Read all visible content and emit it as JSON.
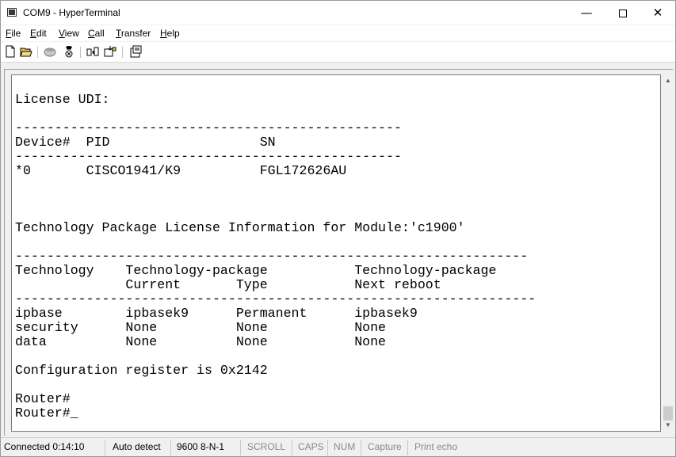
{
  "window": {
    "title": "COM9 - HyperTerminal"
  },
  "controls": {
    "minimize": "—",
    "close": "✕"
  },
  "menu": [
    {
      "label_u": "F",
      "label_rest": "ile"
    },
    {
      "label_u": "E",
      "label_rest": "dit"
    },
    {
      "label_u": "V",
      "label_rest": "iew"
    },
    {
      "label_u": "C",
      "label_rest": "all"
    },
    {
      "label_u": "T",
      "label_rest": "ransfer"
    },
    {
      "label_u": "H",
      "label_rest": "elp"
    }
  ],
  "toolbar": {
    "icons": [
      "new-document-icon",
      "open-folder-icon",
      "connect-phone-icon",
      "disconnect-phone-icon",
      "send-file-icon",
      "receive-file-icon",
      "properties-icon"
    ]
  },
  "terminal": {
    "lines": [
      "",
      "License UDI:",
      "",
      "-------------------------------------------------",
      "Device#  PID                   SN",
      "-------------------------------------------------",
      "*0       CISCO1941/K9          FGL172626AU",
      "",
      "",
      "",
      "Technology Package License Information for Module:'c1900'",
      "",
      "-----------------------------------------------------------------",
      "Technology    Technology-package           Technology-package",
      "              Current       Type           Next reboot",
      "------------------------------------------------------------------",
      "ipbase        ipbasek9      Permanent      ipbasek9",
      "security      None          None           None",
      "data          None          None           None",
      "",
      "Configuration register is 0x2142",
      "",
      "Router#",
      "Router#_"
    ]
  },
  "status": {
    "connected": "Connected 0:14:10",
    "detect": "Auto detect",
    "port": "9600 8-N-1",
    "scroll": "SCROLL",
    "caps": "CAPS",
    "num": "NUM",
    "capture": "Capture",
    "print_echo": "Print echo"
  }
}
